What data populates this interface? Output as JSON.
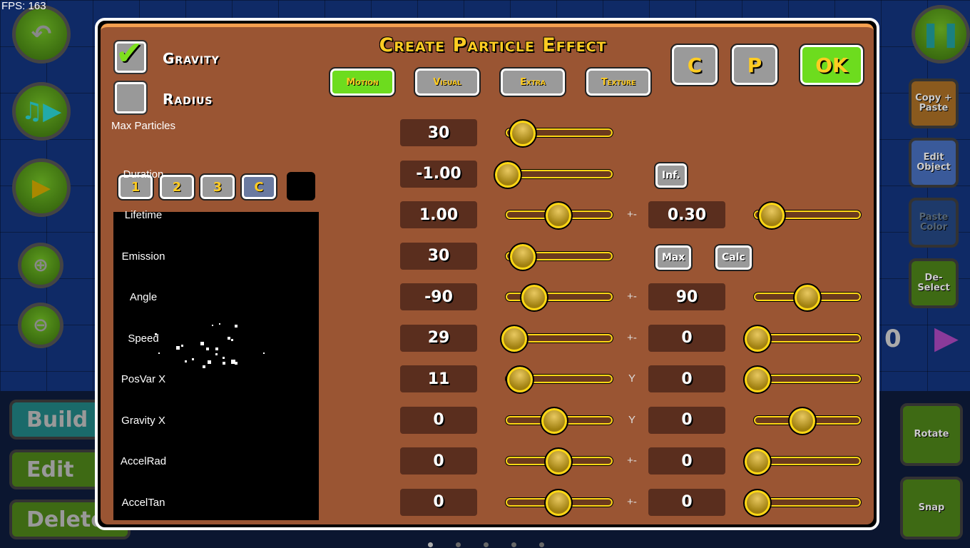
{
  "fps": "FPS: 163",
  "editor": {
    "right_buttons": [
      "Copy + Paste",
      "Edit Object",
      "Paste Color",
      "De-Select"
    ],
    "bottom_right": [
      "Rotate",
      "Snap"
    ],
    "bottom_left": [
      "Build",
      "Edit",
      "Delete"
    ],
    "page_counter": "0"
  },
  "dialog": {
    "title": "Create Particle Effect",
    "gravity_label": "Gravity",
    "gravity_checked": true,
    "radius_label": "Radius",
    "radius_checked": false,
    "tabs": [
      {
        "label": "Motion",
        "active": true
      },
      {
        "label": "Visual"
      },
      {
        "label": "Extra"
      },
      {
        "label": "Texture"
      }
    ],
    "c_button": "C",
    "p_button": "P",
    "ok_button": "OK",
    "color_buttons": [
      "1",
      "2",
      "3",
      "C"
    ],
    "inf_button": "Inf.",
    "max_button": "Max",
    "calc_button": "Calc",
    "rows": [
      {
        "label": "Max Particles",
        "value": "30",
        "slider": 0.15
      },
      {
        "label": "Duration",
        "value": "-1.00",
        "slider": 0.1
      },
      {
        "label": "Lifetime",
        "value": "1.00",
        "slider": 0.49,
        "sep": "+-",
        "value2": "0.30",
        "slider2": 0.16
      },
      {
        "label": "Emission",
        "value": "30",
        "slider": 0.15
      },
      {
        "label": "Angle",
        "value": "-90",
        "slider": 0.26,
        "sep": "+-",
        "value2": "90",
        "slider2": 0.5
      },
      {
        "label": "Speed",
        "value": "29",
        "slider": 0.07,
        "sep": "+-",
        "value2": "0",
        "slider2": 0.02
      },
      {
        "label": "PosVar X",
        "value": "11",
        "slider": 0.12,
        "sep": "Y",
        "value2": "0",
        "slider2": 0.02
      },
      {
        "label": "Gravity X",
        "value": "0",
        "slider": 0.45,
        "sep": "Y",
        "value2": "0",
        "slider2": 0.45
      },
      {
        "label": "AccelRad",
        "value": "0",
        "slider": 0.49,
        "sep": "+-",
        "value2": "0",
        "slider2": 0.02
      },
      {
        "label": "AccelTan",
        "value": "0",
        "slider": 0.49,
        "sep": "+-",
        "value2": "0",
        "slider2": 0.02
      }
    ]
  }
}
